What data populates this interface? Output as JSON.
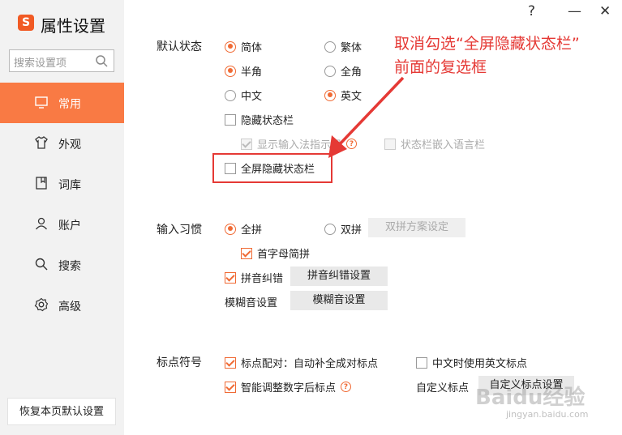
{
  "app": {
    "logo_char": "S",
    "title": "属性设置"
  },
  "window_controls": {
    "help": "?",
    "minimize": "—",
    "close": "✕"
  },
  "search": {
    "placeholder": "搜索设置项"
  },
  "nav": [
    {
      "label": "常用",
      "icon": "monitor-icon",
      "active": true
    },
    {
      "label": "外观",
      "icon": "shirt-icon"
    },
    {
      "label": "词库",
      "icon": "book-icon"
    },
    {
      "label": "账户",
      "icon": "user-icon"
    },
    {
      "label": "搜索",
      "icon": "search-icon"
    },
    {
      "label": "高级",
      "icon": "gear-icon"
    }
  ],
  "reset_button": "恢复本页默认设置",
  "default_state": {
    "title": "默认状态",
    "simplified": "简体",
    "traditional": "繁体",
    "half_width": "半角",
    "full_width": "全角",
    "chinese": "中文",
    "english": "英文",
    "hide_status_bar": "隐藏状态栏",
    "show_ime_indicator": "显示输入法指示器",
    "embed_status_bar": "状态栏嵌入语言栏",
    "fullscreen_hide": "全屏隐藏状态栏"
  },
  "input_habit": {
    "title": "输入习惯",
    "quanpin": "全拼",
    "shuangpin": "双拼",
    "shuangpin_btn": "双拼方案设定",
    "initial_abbrev": "首字母简拼",
    "pinyin_correction": "拼音纠错",
    "pinyin_correction_btn": "拼音纠错设置",
    "fuzzy_label": "模糊音设置",
    "fuzzy_btn": "模糊音设置"
  },
  "punctuation": {
    "title": "标点符号",
    "auto_pair": "标点配对：自动补全成对标点",
    "english_punct": "中文时使用英文标点",
    "smart_adjust": "智能调整数字后标点",
    "custom_label": "自定义标点",
    "custom_btn": "自定义标点设置"
  },
  "annotation": {
    "line1": "取消勾选“全屏隐藏状态栏”",
    "line2": "前面的复选框"
  },
  "watermark": {
    "main": "Baidu经验",
    "sub": "jingyan.baidu.com"
  },
  "colors": {
    "accent": "#f97a44",
    "annotation": "#e53935"
  }
}
